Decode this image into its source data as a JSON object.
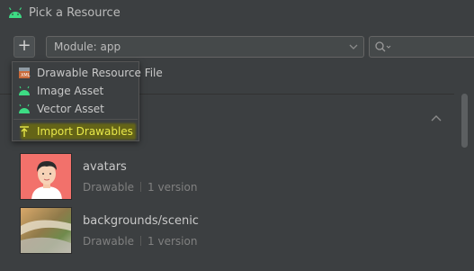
{
  "window": {
    "title": "Pick a Resource"
  },
  "toolbar": {
    "add_label": "+",
    "module_label": "Module: app"
  },
  "menu": {
    "items": [
      {
        "label": "Drawable Resource File",
        "icon": "drawable-file-icon"
      },
      {
        "label": "Image Asset",
        "icon": "android-icon"
      },
      {
        "label": "Vector Asset",
        "icon": "android-icon"
      },
      {
        "label": "Import Drawables",
        "icon": "import-icon",
        "highlighted": true
      }
    ]
  },
  "resources": [
    {
      "name": "avatars",
      "type": "Drawable",
      "versions": "1 version",
      "thumb": "avatar-thumbnail"
    },
    {
      "name": "backgrounds/scenic",
      "type": "Drawable",
      "versions": "1 version",
      "thumb": "scenic-thumbnail"
    }
  ],
  "colors": {
    "accent_android": "#3ddc84",
    "highlight": "#6b6b10",
    "highlight_text": "#e8e84a"
  }
}
